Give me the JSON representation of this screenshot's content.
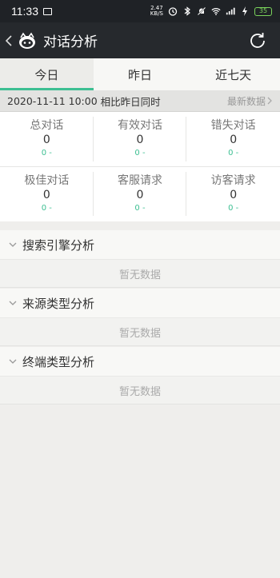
{
  "status_bar": {
    "time": "11:33",
    "net_speed_value": "2.47",
    "net_speed_unit": "KB/S",
    "battery": "35"
  },
  "header": {
    "title": "对话分析"
  },
  "tabs": [
    {
      "label": "今日",
      "active": true
    },
    {
      "label": "昨日",
      "active": false
    },
    {
      "label": "近七天",
      "active": false
    }
  ],
  "compare_bar": {
    "datetime": "2020-11-11 10:00",
    "compare_text": "相比昨日同时",
    "latest_label": "最新数据"
  },
  "stats": [
    {
      "label": "总对话",
      "value": "0",
      "delta": "0 -"
    },
    {
      "label": "有效对话",
      "value": "0",
      "delta": "0 -"
    },
    {
      "label": "错失对话",
      "value": "0",
      "delta": "0 -"
    },
    {
      "label": "极佳对话",
      "value": "0",
      "delta": "0 -"
    },
    {
      "label": "客服请求",
      "value": "0",
      "delta": "0 -"
    },
    {
      "label": "访客请求",
      "value": "0",
      "delta": "0 -"
    }
  ],
  "sections": [
    {
      "title": "搜索引擎分析",
      "empty_text": "暂无数据"
    },
    {
      "title": "来源类型分析",
      "empty_text": "暂无数据"
    },
    {
      "title": "终端类型分析",
      "empty_text": "暂无数据"
    }
  ],
  "colors": {
    "accent": "#3dbf92",
    "header_bg": "#26292d",
    "status_bg": "#1f2226"
  },
  "icons": {
    "back": "chevron-left-icon",
    "logo": "robot-icon",
    "refresh": "refresh-icon",
    "section_toggle": "chevron-down-icon",
    "latest": "chevron-right-icon"
  }
}
